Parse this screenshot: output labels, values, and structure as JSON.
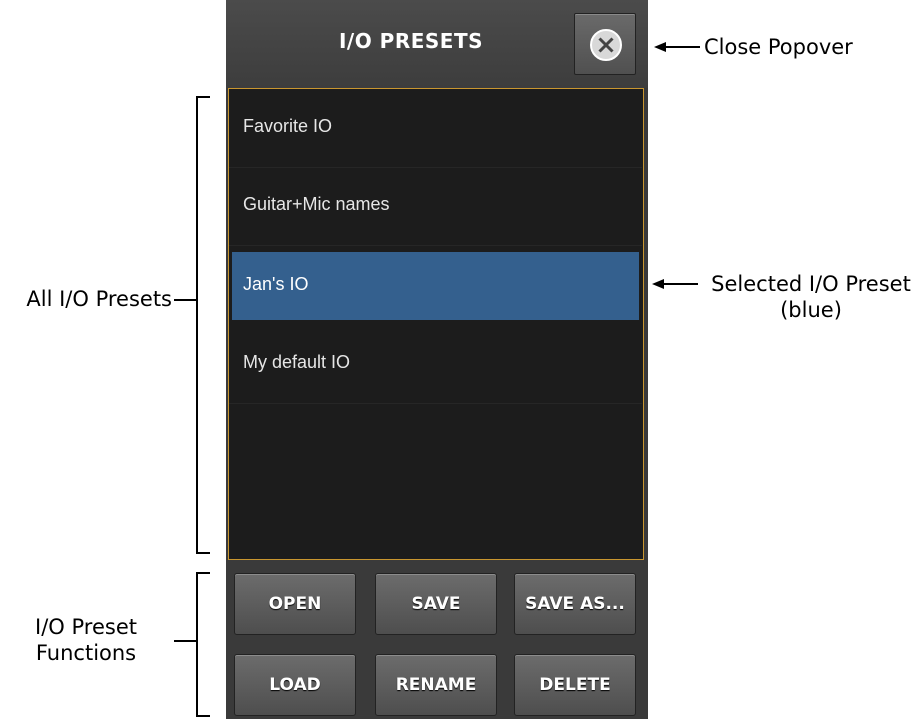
{
  "popover": {
    "title": "I/O PRESETS",
    "presets": [
      {
        "label": "Favorite IO",
        "selected": false
      },
      {
        "label": "Guitar+Mic names",
        "selected": false
      },
      {
        "label": "Jan's IO",
        "selected": true
      },
      {
        "label": "My default IO",
        "selected": false
      }
    ],
    "functions": {
      "open": "OPEN",
      "save": "SAVE",
      "save_as": "SAVE AS...",
      "load": "LOAD",
      "rename": "RENAME",
      "delete": "DELETE"
    },
    "colors": {
      "selected": "#34608e",
      "list_border": "#c9962f"
    }
  },
  "annotations": {
    "close": "Close Popover",
    "selected_line1": "Selected I/O Preset",
    "selected_line2": "(blue)",
    "all_presets": "All I/O Presets",
    "functions_line1": "I/O Preset",
    "functions_line2": "Functions"
  }
}
